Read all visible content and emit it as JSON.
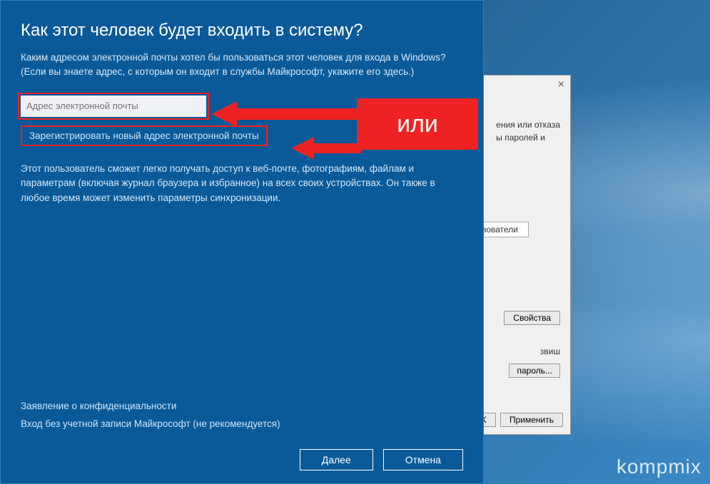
{
  "dialog": {
    "title": "Как этот человек будет входить в систему?",
    "description": "Каким адресом электронной почты хотел бы пользоваться этот человек для входа в Windows? (Если вы знаете адрес, с которым он входит в службы Майкрософт, укажите его здесь.)",
    "email_placeholder": "Адрес электронной почты",
    "register_link": "Зарегистрировать новый адрес электронной почты",
    "description2": "Этот пользователь сможет легко получать доступ к веб-почте, фотографиям, файлам и параметрам (включая журнал браузера и избранное) на всех своих устройствах. Он также в любое время может изменить параметры синхронизации.",
    "privacy_link": "Заявление о конфиденциальности",
    "no_account_link": "Вход без учетной записи Майкрософт (не рекомендуется)",
    "next_button": "Далее",
    "cancel_button": "Отмена"
  },
  "annotation": {
    "or_label": "или"
  },
  "back_window": {
    "partial_text_1a": "ения или отказа",
    "partial_text_1b": "ы паролей и",
    "tab_label": "льзователи",
    "properties_button": "Свойства",
    "partial_text_2": "звиш",
    "password_button": "пароль...",
    "ok_button": "OK",
    "apply_button": "Применить"
  },
  "watermark": "kompmix"
}
